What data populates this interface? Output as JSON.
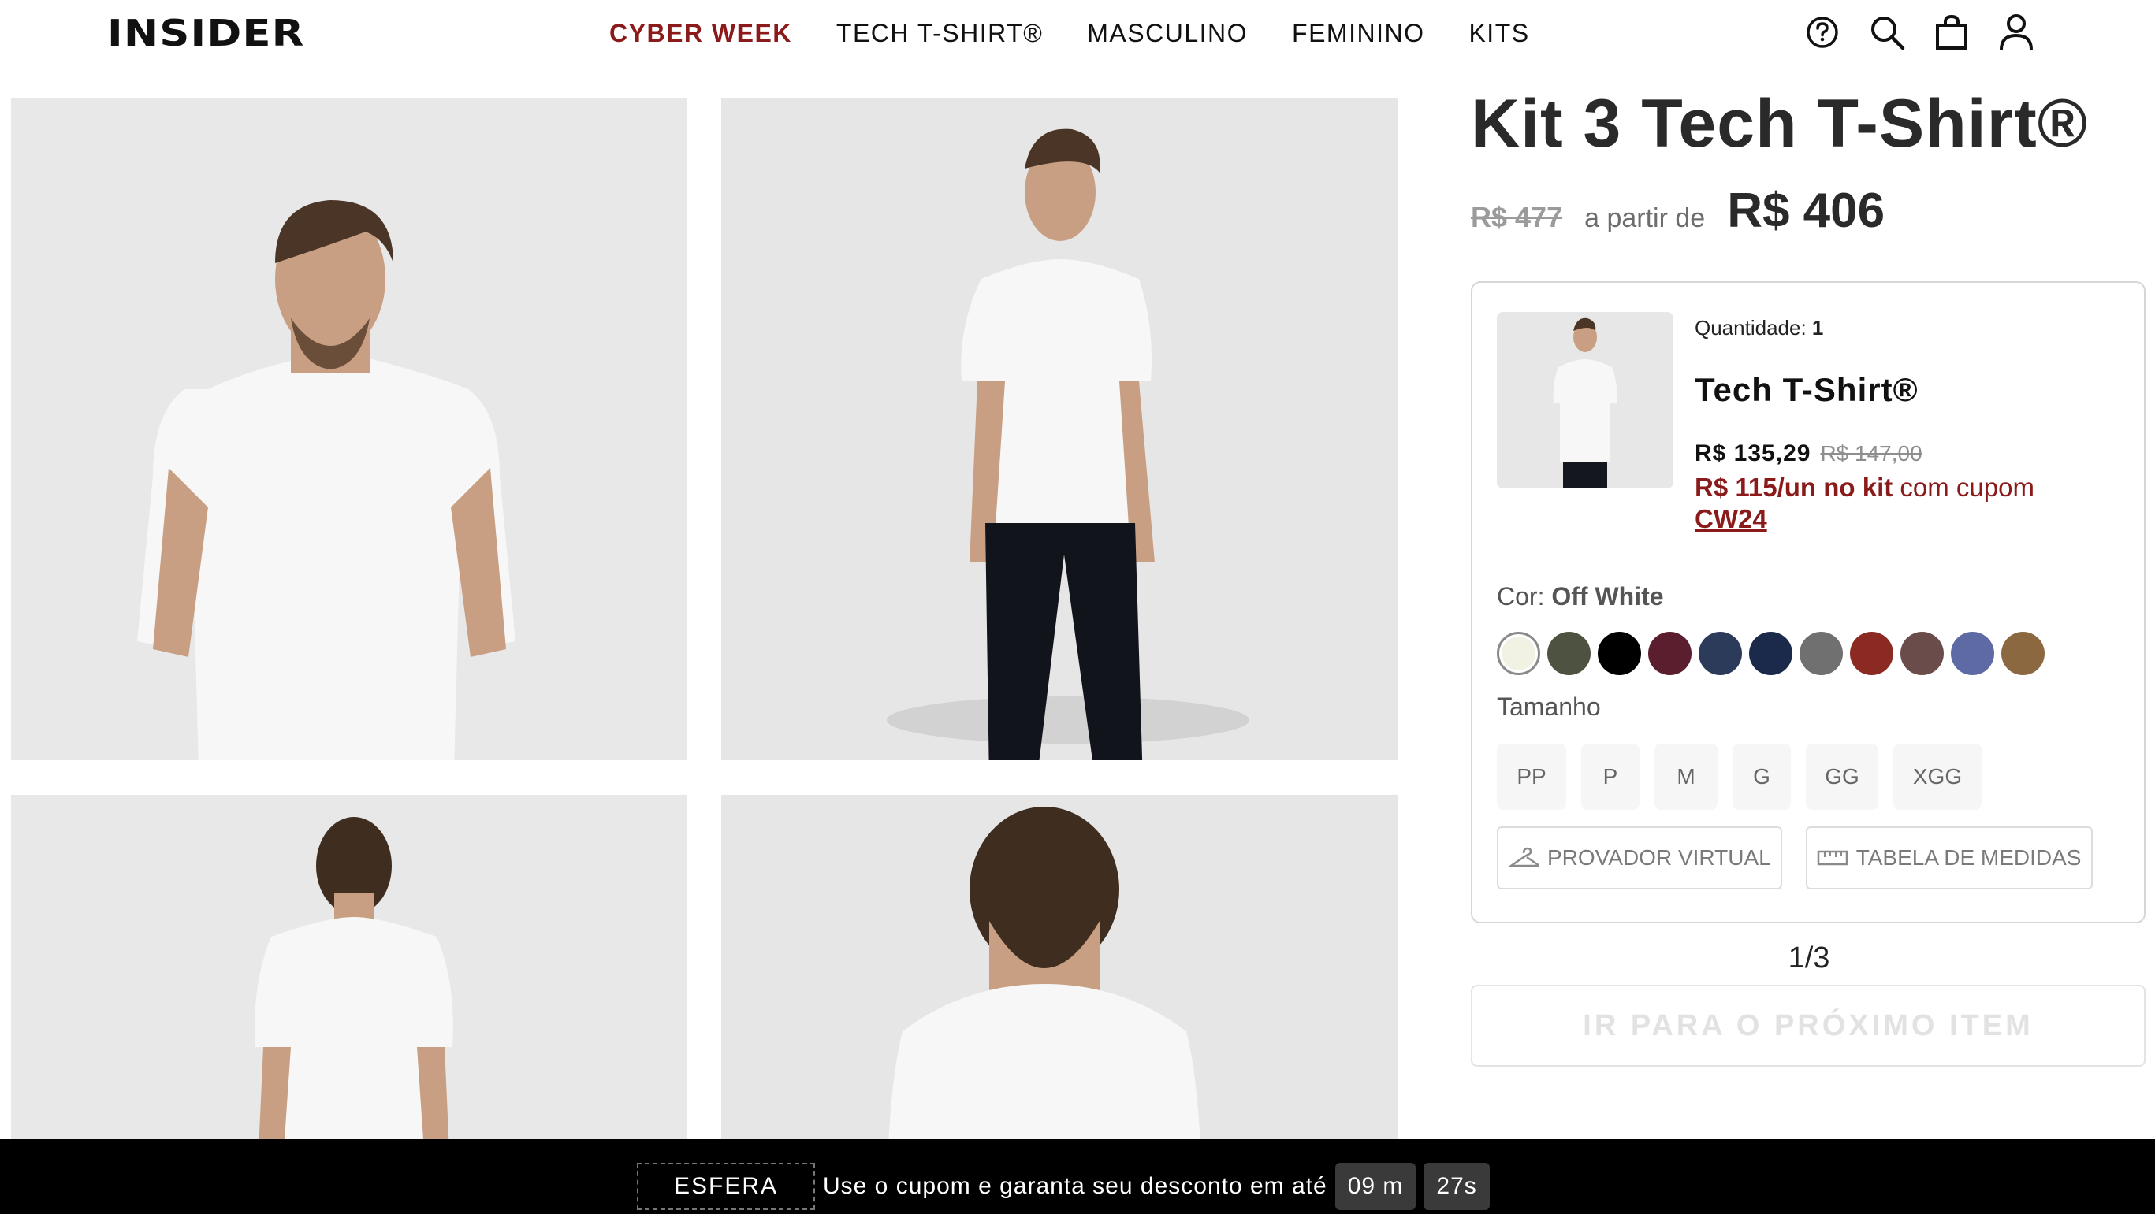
{
  "header": {
    "logo": "INSIDER",
    "nav": [
      {
        "label": "CYBER WEEK",
        "color": "#8b1a1a"
      },
      {
        "label": "TECH T-SHIRT®"
      },
      {
        "label": "MASCULINO"
      },
      {
        "label": "FEMININO"
      },
      {
        "label": "KITS"
      }
    ],
    "icons": [
      "help-icon",
      "search-icon",
      "bag-icon",
      "user-icon"
    ]
  },
  "product": {
    "title": "Kit 3 Tech T-Shirt®",
    "old_price": "R$ 477",
    "from_label": "a partir de",
    "price": "R$ 406"
  },
  "item": {
    "quantity_label": "Quantidade:",
    "quantity": "1",
    "name": "Tech T-Shirt®",
    "price": "R$ 135,29",
    "old_price": "R$ 147,00",
    "promo_bold": "R$ 115/un no kit",
    "promo_text": "com cupom",
    "promo_code": "CW24",
    "color_label": "Cor:",
    "color_value": "Off White",
    "colors": [
      "#f1f2e4",
      "#4e5341",
      "#000000",
      "#5b1e2e",
      "#2d3b5a",
      "#1b2a4a",
      "#707070",
      "#8b2a23",
      "#6a4d4a",
      "#5d6aa3",
      "#8b6840"
    ],
    "size_label": "Tamanho",
    "sizes": [
      "PP",
      "P",
      "M",
      "G",
      "GG",
      "XGG"
    ],
    "virtual_fitting": "PROVADOR VIRTUAL",
    "size_chart": "TABELA DE MEDIDAS"
  },
  "pager": "1/3",
  "next_button": "IR PARA O PRÓXIMO ITEM",
  "bottom_bar": {
    "coupon": "ESFERA",
    "text": "Use o cupom e garanta seu desconto em até",
    "minutes": "09 m",
    "seconds": "27s"
  }
}
